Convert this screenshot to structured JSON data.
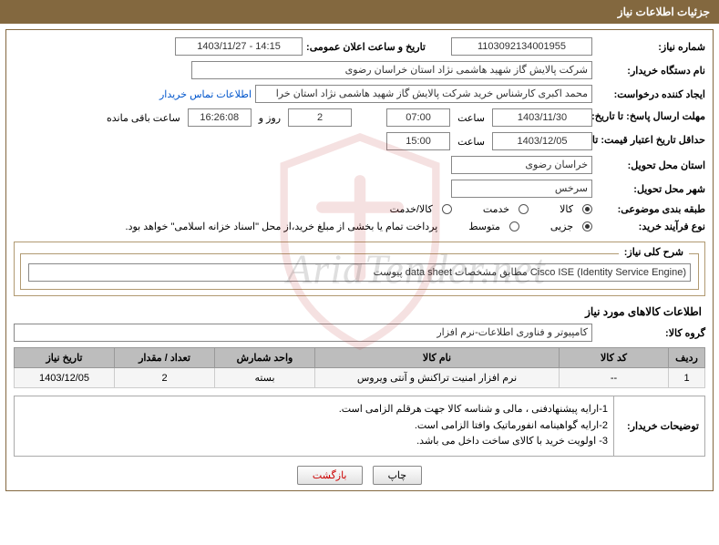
{
  "header": {
    "title": "جزئیات اطلاعات نیاز"
  },
  "need_number": {
    "label": "شماره نیاز:",
    "value": "1103092134001955"
  },
  "announce": {
    "label": "تاریخ و ساعت اعلان عمومی:",
    "value": "14:15 - 1403/11/27"
  },
  "buyer": {
    "label": "نام دستگاه خریدار:",
    "value": "شرکت پالایش گاز شهید هاشمی نژاد   استان خراسان رضوی"
  },
  "requester": {
    "label": "ایجاد کننده درخواست:",
    "value": "محمد اکبری کارشناس خرید شرکت پالایش گاز شهید هاشمی نژاد   استان خرا",
    "contact_link": "اطلاعات تماس خریدار"
  },
  "deadline": {
    "label": "مهلت ارسال پاسخ: تا تاریخ:",
    "date": "1403/11/30",
    "time_label": "ساعت",
    "time": "07:00",
    "days": "2",
    "days_label_pre": "روز و",
    "clock": "16:26:08",
    "remain_label": "ساعت باقی مانده"
  },
  "validity": {
    "label": "حداقل تاریخ اعتبار قیمت: تا تاریخ:",
    "date": "1403/12/05",
    "time_label": "ساعت",
    "time": "15:00"
  },
  "delivery_province": {
    "label": "استان محل تحویل:",
    "value": "خراسان رضوی"
  },
  "delivery_city": {
    "label": "شهر محل تحویل:",
    "value": "سرخس"
  },
  "category": {
    "label": "طبقه بندی موضوعی:",
    "options": [
      "کالا",
      "خدمت",
      "کالا/خدمت"
    ],
    "selected": 0
  },
  "process": {
    "label": "نوع فرآیند خرید:",
    "options": [
      "جزیی",
      "متوسط"
    ],
    "selected": 0,
    "note": "پرداخت تمام یا بخشی از مبلغ خرید،از محل \"اسناد خزانه اسلامی\" خواهد بود."
  },
  "description": {
    "label": "شرح کلی نیاز:",
    "value": "Cisco ISE (Identity Service Engine) مطابق مشخصات data sheet پیوست"
  },
  "goods_section": {
    "title": "اطلاعات کالاهای مورد نیاز"
  },
  "group": {
    "label": "گروه کالا:",
    "value": "کامپیوتر و فناوری اطلاعات-نرم افزار"
  },
  "table": {
    "headers": [
      "ردیف",
      "کد کالا",
      "نام کالا",
      "واحد شمارش",
      "تعداد / مقدار",
      "تاریخ نیاز"
    ],
    "rows": [
      {
        "idx": "1",
        "code": "--",
        "name": "نرم افزار امنیت تراکنش و آنتی ویروس",
        "unit": "بسته",
        "qty": "2",
        "date": "1403/12/05"
      }
    ]
  },
  "notes": {
    "label": "توضیحات خریدار:",
    "line1": "1-ارایه پیشنهادفنی ، مالی و شناسه کالا جهت هرقلم الزامی است.",
    "line2": "2-ارایه گواهینامه انفورماتیک وافتا الزامی است.",
    "line3": "3- اولویت خرید  با کالای ساخت  داخل می باشد."
  },
  "buttons": {
    "print": "چاپ",
    "back": "بازگشت"
  },
  "watermark": {
    "text": "AriaTender.net"
  }
}
